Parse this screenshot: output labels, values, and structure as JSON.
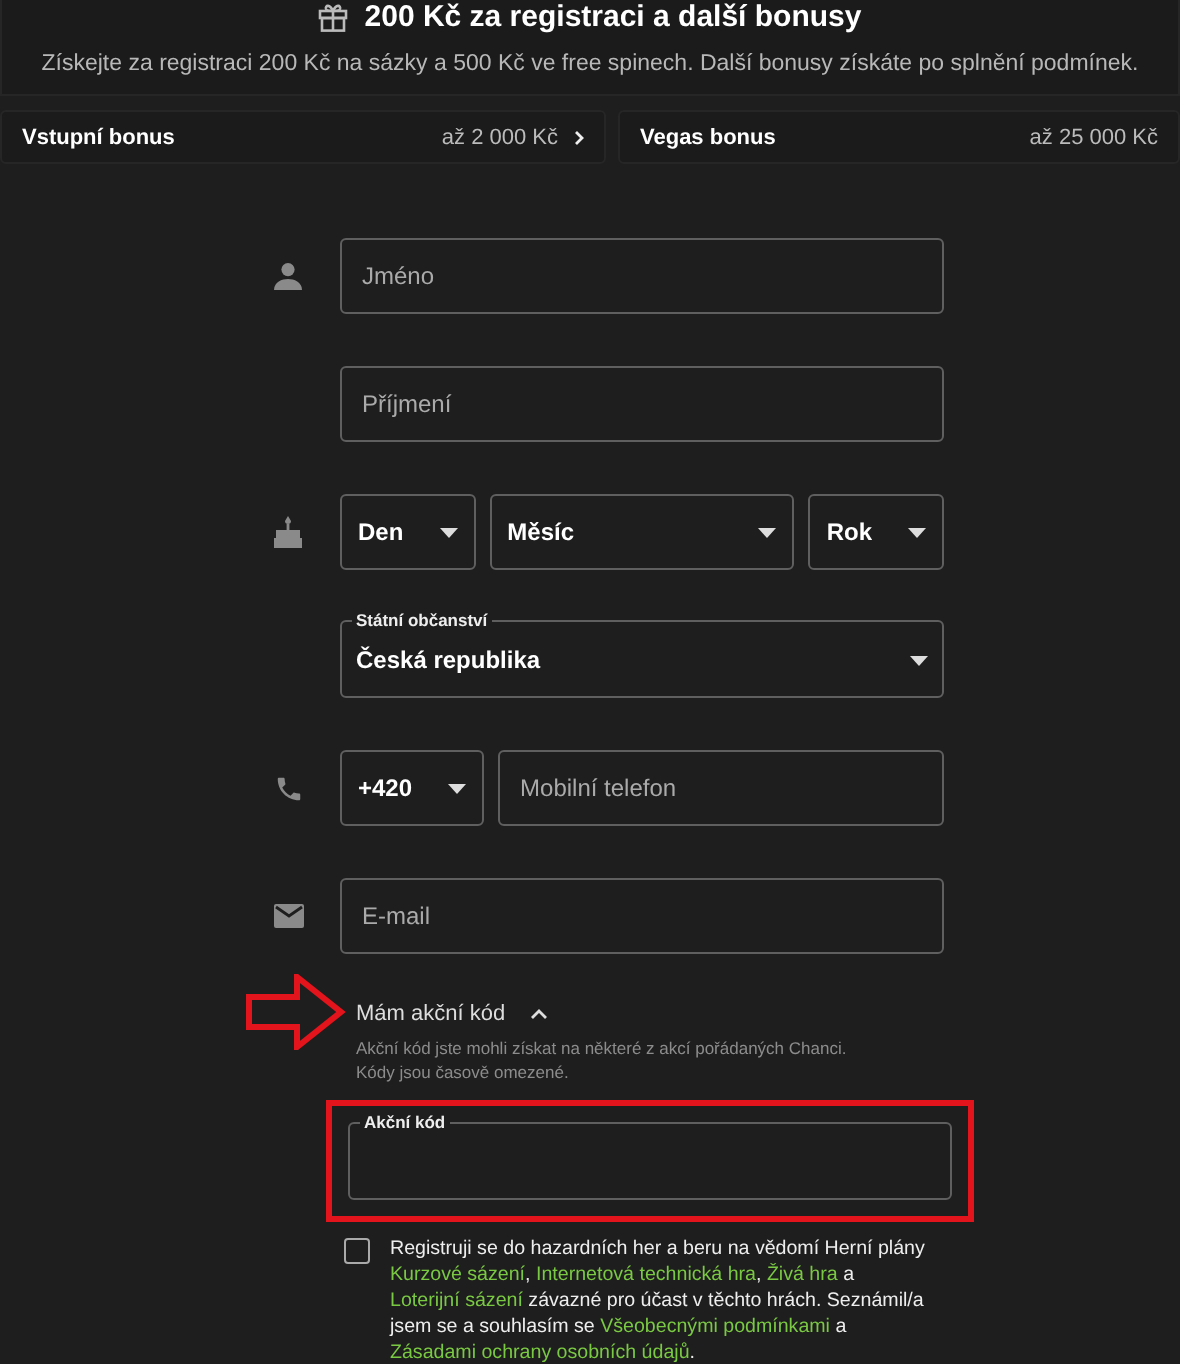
{
  "banner": {
    "title": "200 Kč za registraci a další bonusy",
    "subtitle": "Získejte za registraci 200 Kč na sázky a 500 Kč ve free spinech. Další bonusy získáte po splnění podmínek."
  },
  "bonuses": [
    {
      "label": "Vstupní bonus",
      "amount": "až 2 000 Kč",
      "has_arrow": true
    },
    {
      "label": "Vegas bonus",
      "amount": "až 25 000 Kč",
      "has_arrow": false
    }
  ],
  "form": {
    "rows": [
      {
        "kind": "name",
        "fields": [
          {
            "kind": "input",
            "placeholder": "Jméno"
          }
        ]
      },
      {
        "kind": "surname",
        "fields": [
          {
            "kind": "input",
            "placeholder": "Příjmení"
          }
        ]
      },
      {
        "kind": "birthdate",
        "fields": [
          {
            "kind": "select",
            "value": "Den"
          },
          {
            "kind": "select",
            "value": "Měsíc"
          },
          {
            "kind": "select",
            "value": "Rok"
          }
        ]
      },
      {
        "kind": "citizenship",
        "fields": [
          {
            "kind": "select",
            "label": "Státní občanství",
            "value": "Česká republika"
          }
        ]
      },
      {
        "kind": "phone",
        "fields": [
          {
            "kind": "select",
            "value": "+420"
          },
          {
            "kind": "input",
            "placeholder": "Mobilní telefon"
          }
        ]
      },
      {
        "kind": "email",
        "fields": [
          {
            "kind": "input",
            "placeholder": "E-mail"
          }
        ]
      }
    ]
  },
  "promo": {
    "toggle_label": "Mám akční kód",
    "expanded": true,
    "hint": "Akční kód jste mohli získat na některé z akcí pořádaných Chanci. Kódy jsou časově omezené.",
    "field_label": "Akční kód"
  },
  "consent": {
    "checked": false,
    "segments": [
      {
        "kind": "text",
        "text": "Registruji se do hazardních her a beru na vědomí Herní plány "
      },
      {
        "kind": "link",
        "text": "Kurzové sázení"
      },
      {
        "kind": "text",
        "text": ", "
      },
      {
        "kind": "link",
        "text": "Internetová technická hra"
      },
      {
        "kind": "text",
        "text": ", "
      },
      {
        "kind": "link",
        "text": "Živá hra"
      },
      {
        "kind": "text",
        "text": " a "
      },
      {
        "kind": "link",
        "text": "Loterijní sázení"
      },
      {
        "kind": "text",
        "text": " závazné pro účast v těchto hrách. Seznámil/a jsem se a souhlasím se "
      },
      {
        "kind": "link",
        "text": "Všeobecnými podmínkami"
      },
      {
        "kind": "text",
        "text": " a "
      },
      {
        "kind": "link",
        "text": "Zásadami ochrany osobních údajů"
      },
      {
        "kind": "text",
        "text": "."
      }
    ]
  }
}
